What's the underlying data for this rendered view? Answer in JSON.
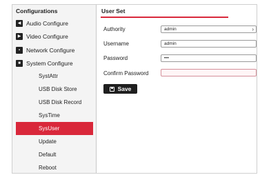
{
  "sidebar": {
    "title": "Configurations",
    "groups": [
      {
        "label": "Audio Configure",
        "icon": "speaker-icon"
      },
      {
        "label": "Video Configure",
        "icon": "video-icon"
      },
      {
        "label": "Network Configure",
        "icon": "network-icon"
      },
      {
        "label": "System Configure",
        "icon": "system-icon"
      }
    ],
    "sub_items": [
      "SystAttr",
      "USB Disk Store",
      "USB Disk Record",
      "SysTime",
      "SysUser",
      "Update",
      "Default",
      "Reboot"
    ],
    "active_item": "SysUser"
  },
  "main": {
    "title": "User Set",
    "fields": {
      "authority": {
        "label": "Authority",
        "value": "admin"
      },
      "username": {
        "label": "Username",
        "value": "admin"
      },
      "password": {
        "label": "Password",
        "value": "•••"
      },
      "confirm_password": {
        "label": "Confirm Password",
        "value": ""
      }
    },
    "save_label": "Save"
  },
  "colors": {
    "accent": "#d9283b",
    "button": "#1f1f1f"
  }
}
